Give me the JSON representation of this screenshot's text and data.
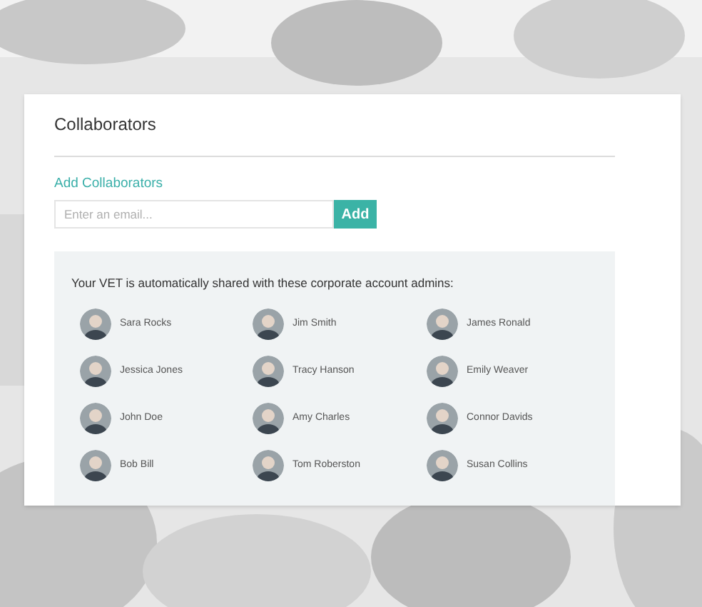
{
  "card": {
    "title": "Collaborators"
  },
  "add_collaborators": {
    "label": "Add Collaborators",
    "email_field": {
      "placeholder": "Enter an email..."
    },
    "button": "Add"
  },
  "admins_panel": {
    "heading": "Your VET is automatically shared with these corporate account admins:",
    "admins": [
      {
        "name": "Sara Rocks"
      },
      {
        "name": "Jim Smith"
      },
      {
        "name": "James Ronald"
      },
      {
        "name": "Jessica Jones"
      },
      {
        "name": "Tracy Hanson"
      },
      {
        "name": "Emily Weaver"
      },
      {
        "name": "John Doe"
      },
      {
        "name": "Amy Charles"
      },
      {
        "name": "Connor Davids"
      },
      {
        "name": "Bob Bill"
      },
      {
        "name": "Tom Roberston"
      },
      {
        "name": "Susan Collins"
      }
    ]
  }
}
